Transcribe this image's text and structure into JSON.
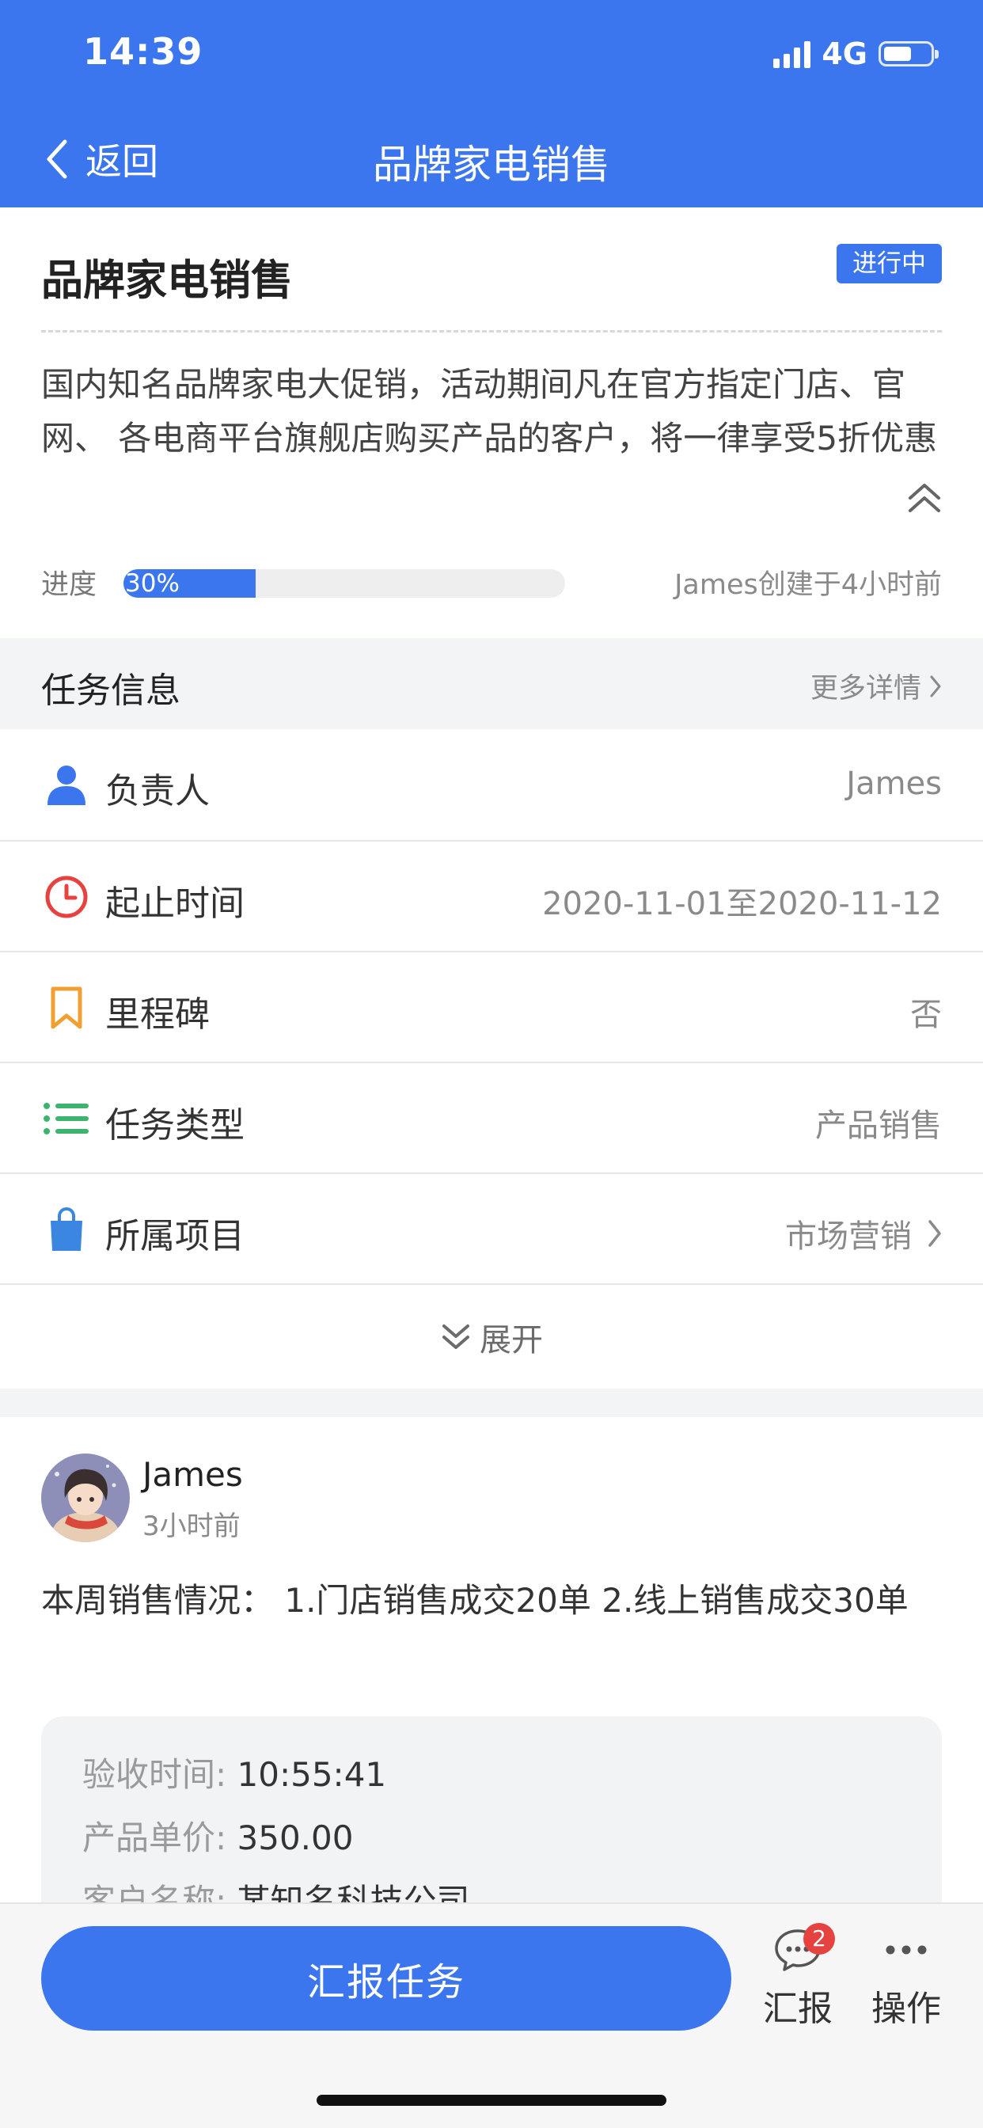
{
  "status_bar": {
    "time": "14:39",
    "network": "4G"
  },
  "nav": {
    "back_label": "返回",
    "title": "品牌家电销售"
  },
  "task": {
    "title": "品牌家电销售",
    "status": "进行中",
    "description": "国内知名品牌家电大促销，活动期间凡在官方指定门店、官网、 各电商平台旗舰店购买产品的客户，将一律享受5折优惠",
    "progress_label": "进度",
    "progress_percent": 30,
    "progress_text": "30%",
    "created_by": "James创建于4小时前"
  },
  "info_section": {
    "title": "任务信息",
    "more_label": "更多详情",
    "rows": [
      {
        "icon": "person-icon",
        "label": "负责人",
        "value": "James",
        "color": "#3b76ef"
      },
      {
        "icon": "clock-icon",
        "label": "起止时间",
        "value": "2020-11-01至2020-11-12",
        "color": "#e64340"
      },
      {
        "icon": "bookmark-icon",
        "label": "里程碑",
        "value": "否",
        "color": "#f0a030"
      },
      {
        "icon": "list-icon",
        "label": "任务类型",
        "value": "产品销售",
        "color": "#3cb46e"
      },
      {
        "icon": "shopping-bag-icon",
        "label": "所属项目",
        "value": "市场营销",
        "color": "#3b86e0"
      }
    ],
    "expand_label": "展开"
  },
  "report": {
    "author": "James",
    "time": "3小时前",
    "text": "本周销售情况： 1.门店销售成交20单 2.线上销售成交30单",
    "details": [
      {
        "key": "验收时间:",
        "value": "10:55:41"
      },
      {
        "key": "产品单价:",
        "value": "350.00"
      },
      {
        "key": "客户名称:",
        "value": "某知名科技公司"
      }
    ]
  },
  "bottom_bar": {
    "primary_button": "汇报任务",
    "report_label": "汇报",
    "report_badge": "2",
    "actions_label": "操作"
  },
  "colors": {
    "brand": "#3b76ef",
    "badge_red": "#e64340"
  }
}
